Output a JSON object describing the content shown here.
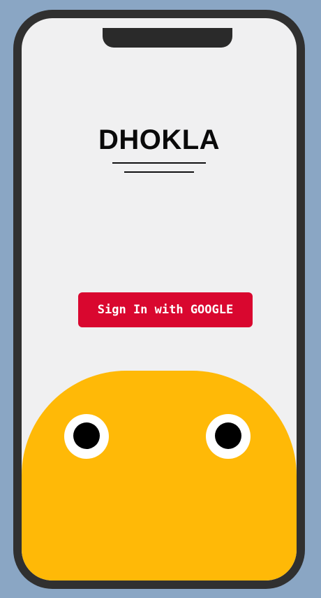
{
  "app": {
    "title": "DHOKLA"
  },
  "auth": {
    "signin_label": "Sign In with GOOGLE"
  },
  "colors": {
    "background": "#8aa6c4",
    "screen": "#f0f0f1",
    "button": "#d9072f",
    "mascot": "#ffb907"
  }
}
